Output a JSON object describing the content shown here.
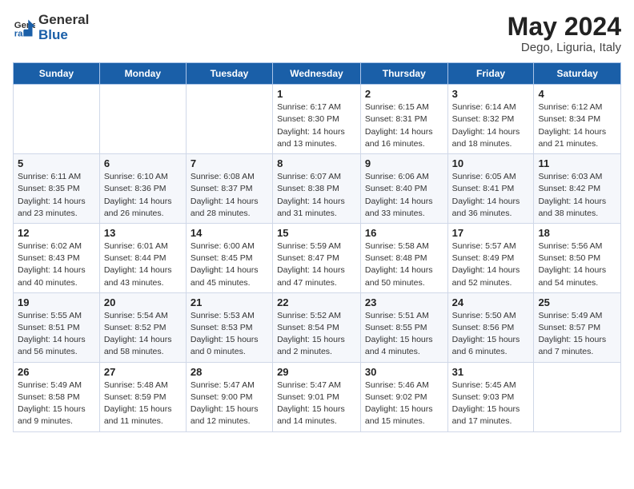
{
  "logo": {
    "general": "General",
    "blue": "Blue"
  },
  "title": {
    "month_year": "May 2024",
    "location": "Dego, Liguria, Italy"
  },
  "days_of_week": [
    "Sunday",
    "Monday",
    "Tuesday",
    "Wednesday",
    "Thursday",
    "Friday",
    "Saturday"
  ],
  "weeks": [
    [
      {
        "day": "",
        "info": ""
      },
      {
        "day": "",
        "info": ""
      },
      {
        "day": "",
        "info": ""
      },
      {
        "day": "1",
        "info": "Sunrise: 6:17 AM\nSunset: 8:30 PM\nDaylight: 14 hours\nand 13 minutes."
      },
      {
        "day": "2",
        "info": "Sunrise: 6:15 AM\nSunset: 8:31 PM\nDaylight: 14 hours\nand 16 minutes."
      },
      {
        "day": "3",
        "info": "Sunrise: 6:14 AM\nSunset: 8:32 PM\nDaylight: 14 hours\nand 18 minutes."
      },
      {
        "day": "4",
        "info": "Sunrise: 6:12 AM\nSunset: 8:34 PM\nDaylight: 14 hours\nand 21 minutes."
      }
    ],
    [
      {
        "day": "5",
        "info": "Sunrise: 6:11 AM\nSunset: 8:35 PM\nDaylight: 14 hours\nand 23 minutes."
      },
      {
        "day": "6",
        "info": "Sunrise: 6:10 AM\nSunset: 8:36 PM\nDaylight: 14 hours\nand 26 minutes."
      },
      {
        "day": "7",
        "info": "Sunrise: 6:08 AM\nSunset: 8:37 PM\nDaylight: 14 hours\nand 28 minutes."
      },
      {
        "day": "8",
        "info": "Sunrise: 6:07 AM\nSunset: 8:38 PM\nDaylight: 14 hours\nand 31 minutes."
      },
      {
        "day": "9",
        "info": "Sunrise: 6:06 AM\nSunset: 8:40 PM\nDaylight: 14 hours\nand 33 minutes."
      },
      {
        "day": "10",
        "info": "Sunrise: 6:05 AM\nSunset: 8:41 PM\nDaylight: 14 hours\nand 36 minutes."
      },
      {
        "day": "11",
        "info": "Sunrise: 6:03 AM\nSunset: 8:42 PM\nDaylight: 14 hours\nand 38 minutes."
      }
    ],
    [
      {
        "day": "12",
        "info": "Sunrise: 6:02 AM\nSunset: 8:43 PM\nDaylight: 14 hours\nand 40 minutes."
      },
      {
        "day": "13",
        "info": "Sunrise: 6:01 AM\nSunset: 8:44 PM\nDaylight: 14 hours\nand 43 minutes."
      },
      {
        "day": "14",
        "info": "Sunrise: 6:00 AM\nSunset: 8:45 PM\nDaylight: 14 hours\nand 45 minutes."
      },
      {
        "day": "15",
        "info": "Sunrise: 5:59 AM\nSunset: 8:47 PM\nDaylight: 14 hours\nand 47 minutes."
      },
      {
        "day": "16",
        "info": "Sunrise: 5:58 AM\nSunset: 8:48 PM\nDaylight: 14 hours\nand 50 minutes."
      },
      {
        "day": "17",
        "info": "Sunrise: 5:57 AM\nSunset: 8:49 PM\nDaylight: 14 hours\nand 52 minutes."
      },
      {
        "day": "18",
        "info": "Sunrise: 5:56 AM\nSunset: 8:50 PM\nDaylight: 14 hours\nand 54 minutes."
      }
    ],
    [
      {
        "day": "19",
        "info": "Sunrise: 5:55 AM\nSunset: 8:51 PM\nDaylight: 14 hours\nand 56 minutes."
      },
      {
        "day": "20",
        "info": "Sunrise: 5:54 AM\nSunset: 8:52 PM\nDaylight: 14 hours\nand 58 minutes."
      },
      {
        "day": "21",
        "info": "Sunrise: 5:53 AM\nSunset: 8:53 PM\nDaylight: 15 hours\nand 0 minutes."
      },
      {
        "day": "22",
        "info": "Sunrise: 5:52 AM\nSunset: 8:54 PM\nDaylight: 15 hours\nand 2 minutes."
      },
      {
        "day": "23",
        "info": "Sunrise: 5:51 AM\nSunset: 8:55 PM\nDaylight: 15 hours\nand 4 minutes."
      },
      {
        "day": "24",
        "info": "Sunrise: 5:50 AM\nSunset: 8:56 PM\nDaylight: 15 hours\nand 6 minutes."
      },
      {
        "day": "25",
        "info": "Sunrise: 5:49 AM\nSunset: 8:57 PM\nDaylight: 15 hours\nand 7 minutes."
      }
    ],
    [
      {
        "day": "26",
        "info": "Sunrise: 5:49 AM\nSunset: 8:58 PM\nDaylight: 15 hours\nand 9 minutes."
      },
      {
        "day": "27",
        "info": "Sunrise: 5:48 AM\nSunset: 8:59 PM\nDaylight: 15 hours\nand 11 minutes."
      },
      {
        "day": "28",
        "info": "Sunrise: 5:47 AM\nSunset: 9:00 PM\nDaylight: 15 hours\nand 12 minutes."
      },
      {
        "day": "29",
        "info": "Sunrise: 5:47 AM\nSunset: 9:01 PM\nDaylight: 15 hours\nand 14 minutes."
      },
      {
        "day": "30",
        "info": "Sunrise: 5:46 AM\nSunset: 9:02 PM\nDaylight: 15 hours\nand 15 minutes."
      },
      {
        "day": "31",
        "info": "Sunrise: 5:45 AM\nSunset: 9:03 PM\nDaylight: 15 hours\nand 17 minutes."
      },
      {
        "day": "",
        "info": ""
      }
    ]
  ]
}
